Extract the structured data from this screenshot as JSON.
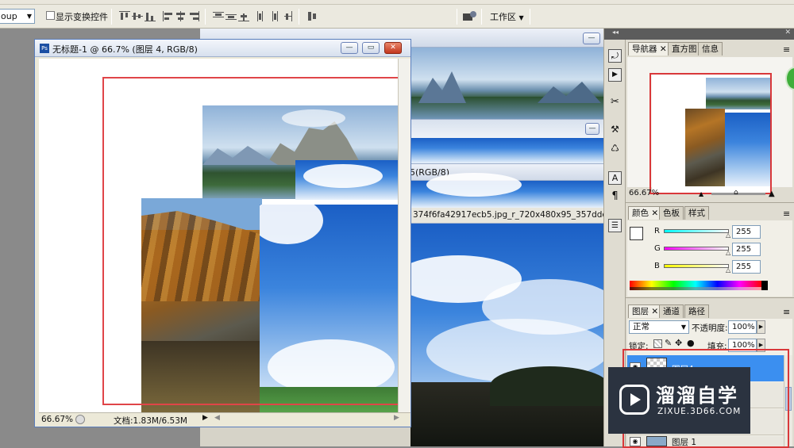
{
  "options_bar": {
    "group_select": "oup",
    "show_transform_label": "显示变换控件",
    "workspace_label": "工作区"
  },
  "doc_window": {
    "title": "无标题-1 @ 66.7% (图层 4, RGB/8)",
    "zoom": "66.67%",
    "doc_size": "文档:1.83M/6.53M"
  },
  "background_window": {
    "title_fragment": "5(RGB/8)",
    "filename_fragment": "374f6fa42917ecb5.jpg_r_720x480x95_357ddce0.jp"
  },
  "navigator_panel": {
    "tabs": [
      "导航器",
      "直方图",
      "信息"
    ],
    "zoom": "66.67%"
  },
  "color_panel": {
    "tabs": [
      "颜色",
      "色板",
      "样式"
    ],
    "channels": [
      {
        "label": "R",
        "value": "255",
        "color": "#e0302a"
      },
      {
        "label": "G",
        "value": "255",
        "color": "#2fa33a"
      },
      {
        "label": "B",
        "value": "255",
        "color": "#2c47c9"
      }
    ]
  },
  "layers_panel": {
    "tabs": [
      "图层",
      "通道",
      "路径"
    ],
    "blend_mode": "正常",
    "opacity_label": "不透明度:",
    "opacity_value": "100%",
    "lock_label": "锁定:",
    "fill_label": "填充:",
    "fill_value": "100%",
    "selected_layer": "图层4",
    "bottom_layer": "图层 1"
  },
  "watermark": {
    "brand": "溜溜自学",
    "url": "ZIXUE.3D66.COM"
  },
  "colors": {
    "selection_blue": "#3b8ff0",
    "highlight_red": "#d9383a",
    "watermark_bg": "#2b3340"
  }
}
